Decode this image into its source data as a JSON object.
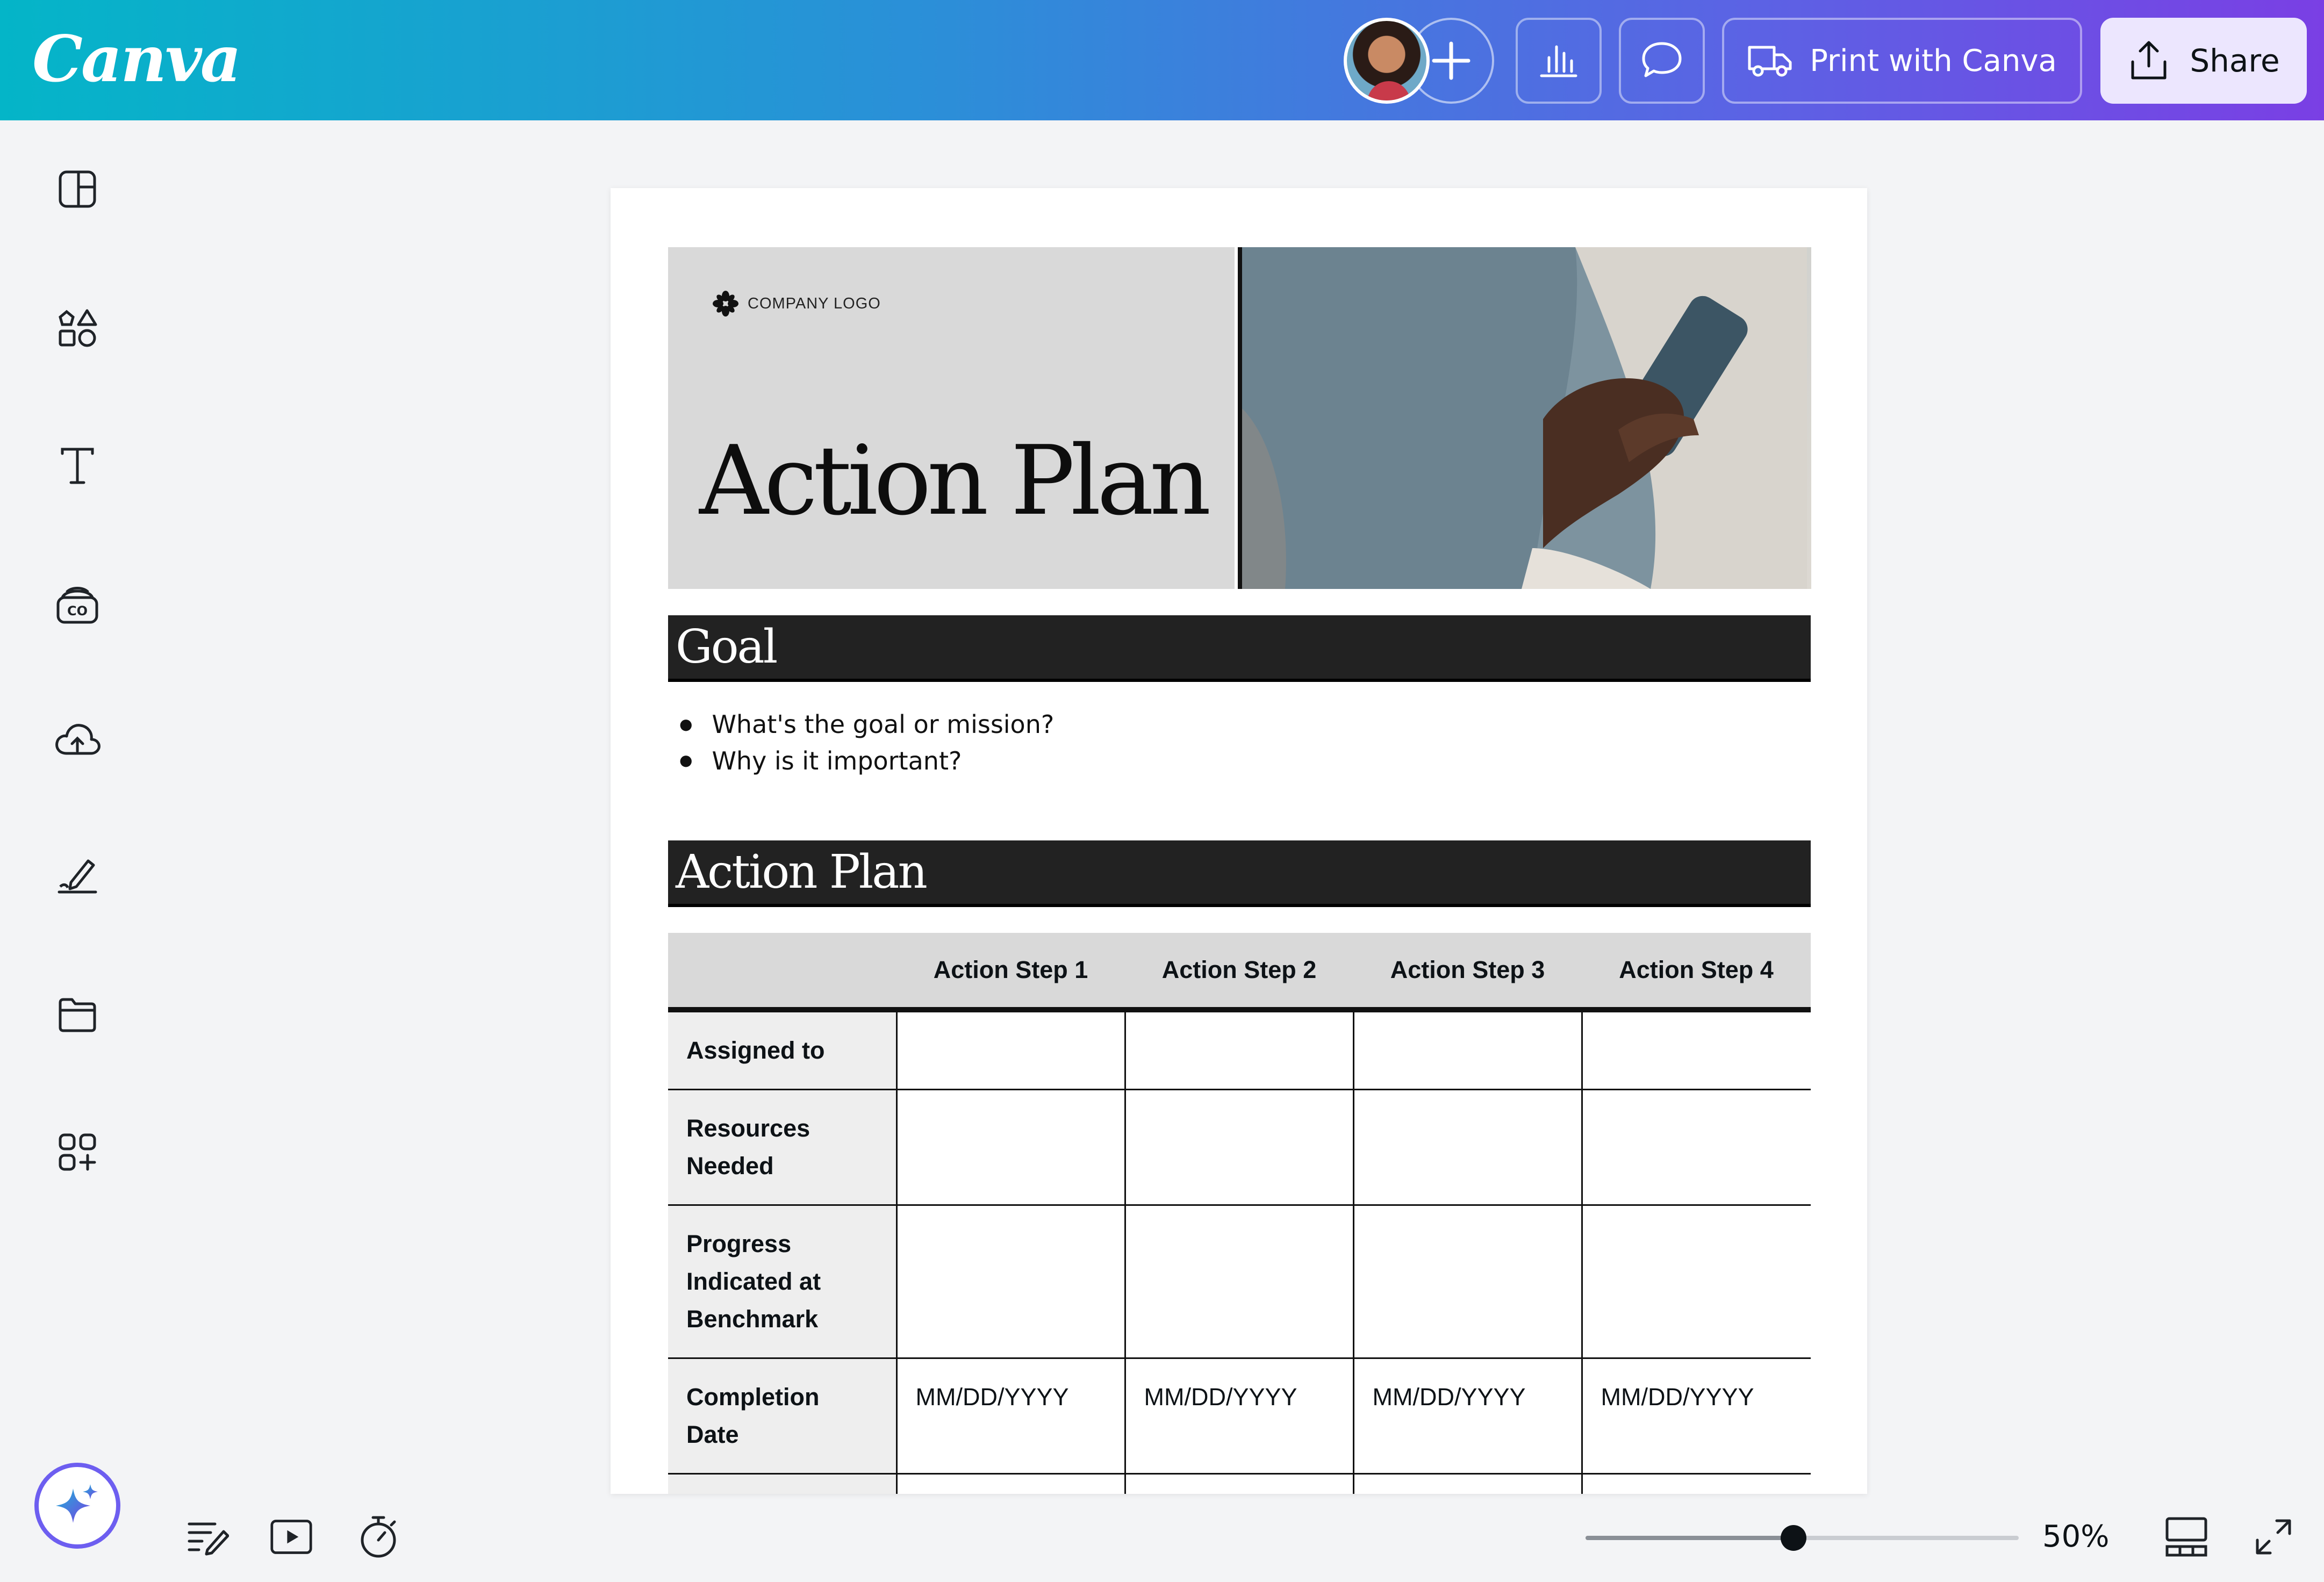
{
  "app": {
    "brand": "Canva",
    "accent_gradient": [
      "#04b5c8",
      "#7a3fe4"
    ]
  },
  "topbar": {
    "print_label": "Print with Canva",
    "share_label": "Share"
  },
  "left_rail": {
    "icons": [
      "design-icon",
      "elements-icon",
      "text-icon",
      "brand-icon",
      "uploads-icon",
      "draw-icon",
      "projects-icon",
      "apps-icon"
    ]
  },
  "document": {
    "company_logo": "COMPANY LOGO",
    "title": "Action Plan",
    "goal_heading": "Goal",
    "goal_bullets": [
      "What's the goal or mission?",
      "Why is it important?"
    ],
    "plan_heading": "Action Plan",
    "table": {
      "columns": [
        "",
        "Action Step 1",
        "Action Step 2",
        "Action Step 3",
        "Action Step 4"
      ],
      "rows": [
        [
          "Assigned to",
          "",
          "",
          "",
          ""
        ],
        [
          "Resources Needed",
          "",
          "",
          "",
          ""
        ],
        [
          "Progress Indicated at Benchmark",
          "",
          "",
          "",
          ""
        ],
        [
          "Completion Date",
          "MM/DD/YYYY",
          "MM/DD/YYYY",
          "MM/DD/YYYY",
          "MM/DD/YYYY"
        ],
        [
          "",
          "",
          "",
          "",
          ""
        ]
      ]
    }
  },
  "bottombar": {
    "zoom_label": "50%",
    "zoom_level": 0.48
  }
}
